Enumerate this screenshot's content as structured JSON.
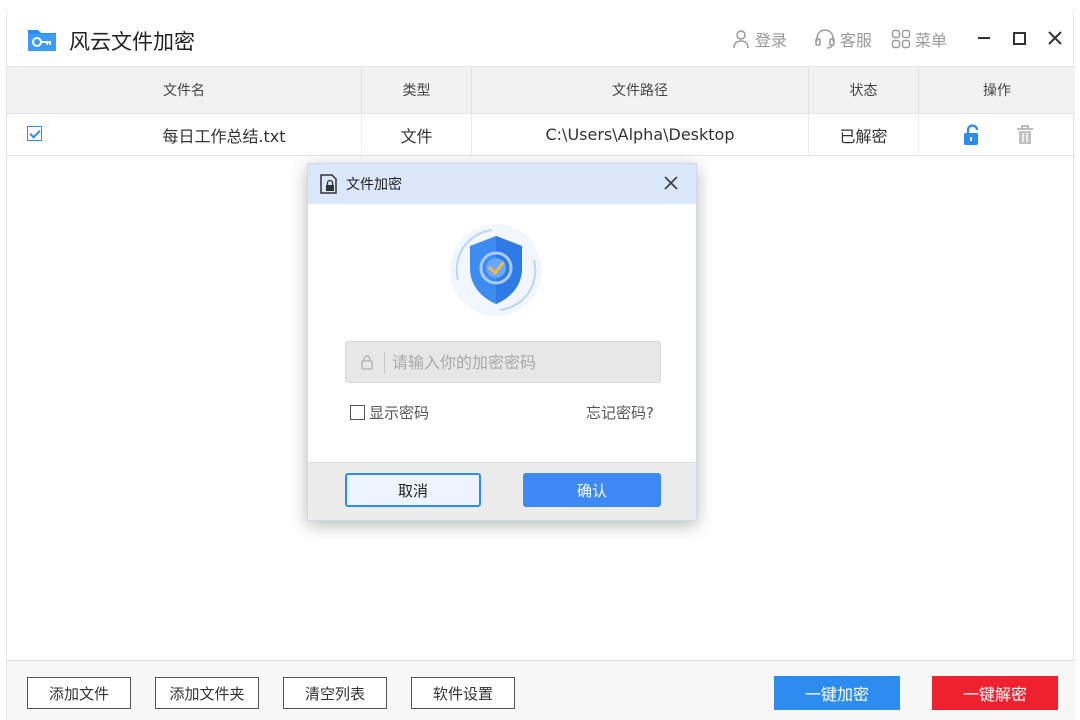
{
  "app": {
    "title": "风云文件加密"
  },
  "titlebar": {
    "login": "登录",
    "service": "客服",
    "menu": "菜单"
  },
  "table": {
    "headers": [
      "文件名",
      "类型",
      "文件路径",
      "状态",
      "操作"
    ],
    "rows": [
      {
        "checked": true,
        "name": "每日工作总结.txt",
        "type": "文件",
        "path": "C:\\Users\\Alpha\\Desktop",
        "status": "已解密"
      }
    ]
  },
  "bottombar": {
    "add_file": "添加文件",
    "add_folder": "添加文件夹",
    "clear_list": "清空列表",
    "settings": "软件设置",
    "encrypt_all": "一键加密",
    "decrypt_all": "一键解密"
  },
  "dialog": {
    "title": "文件加密",
    "password_placeholder": "请输入你的加密密码",
    "password_value": "",
    "show_password": "显示密码",
    "forgot_password": "忘记密码?",
    "cancel": "取消",
    "confirm": "确认"
  },
  "colors": {
    "accent": "#2d8cf0",
    "danger": "#f0212f",
    "dialog_header": "#dbe8fb"
  }
}
